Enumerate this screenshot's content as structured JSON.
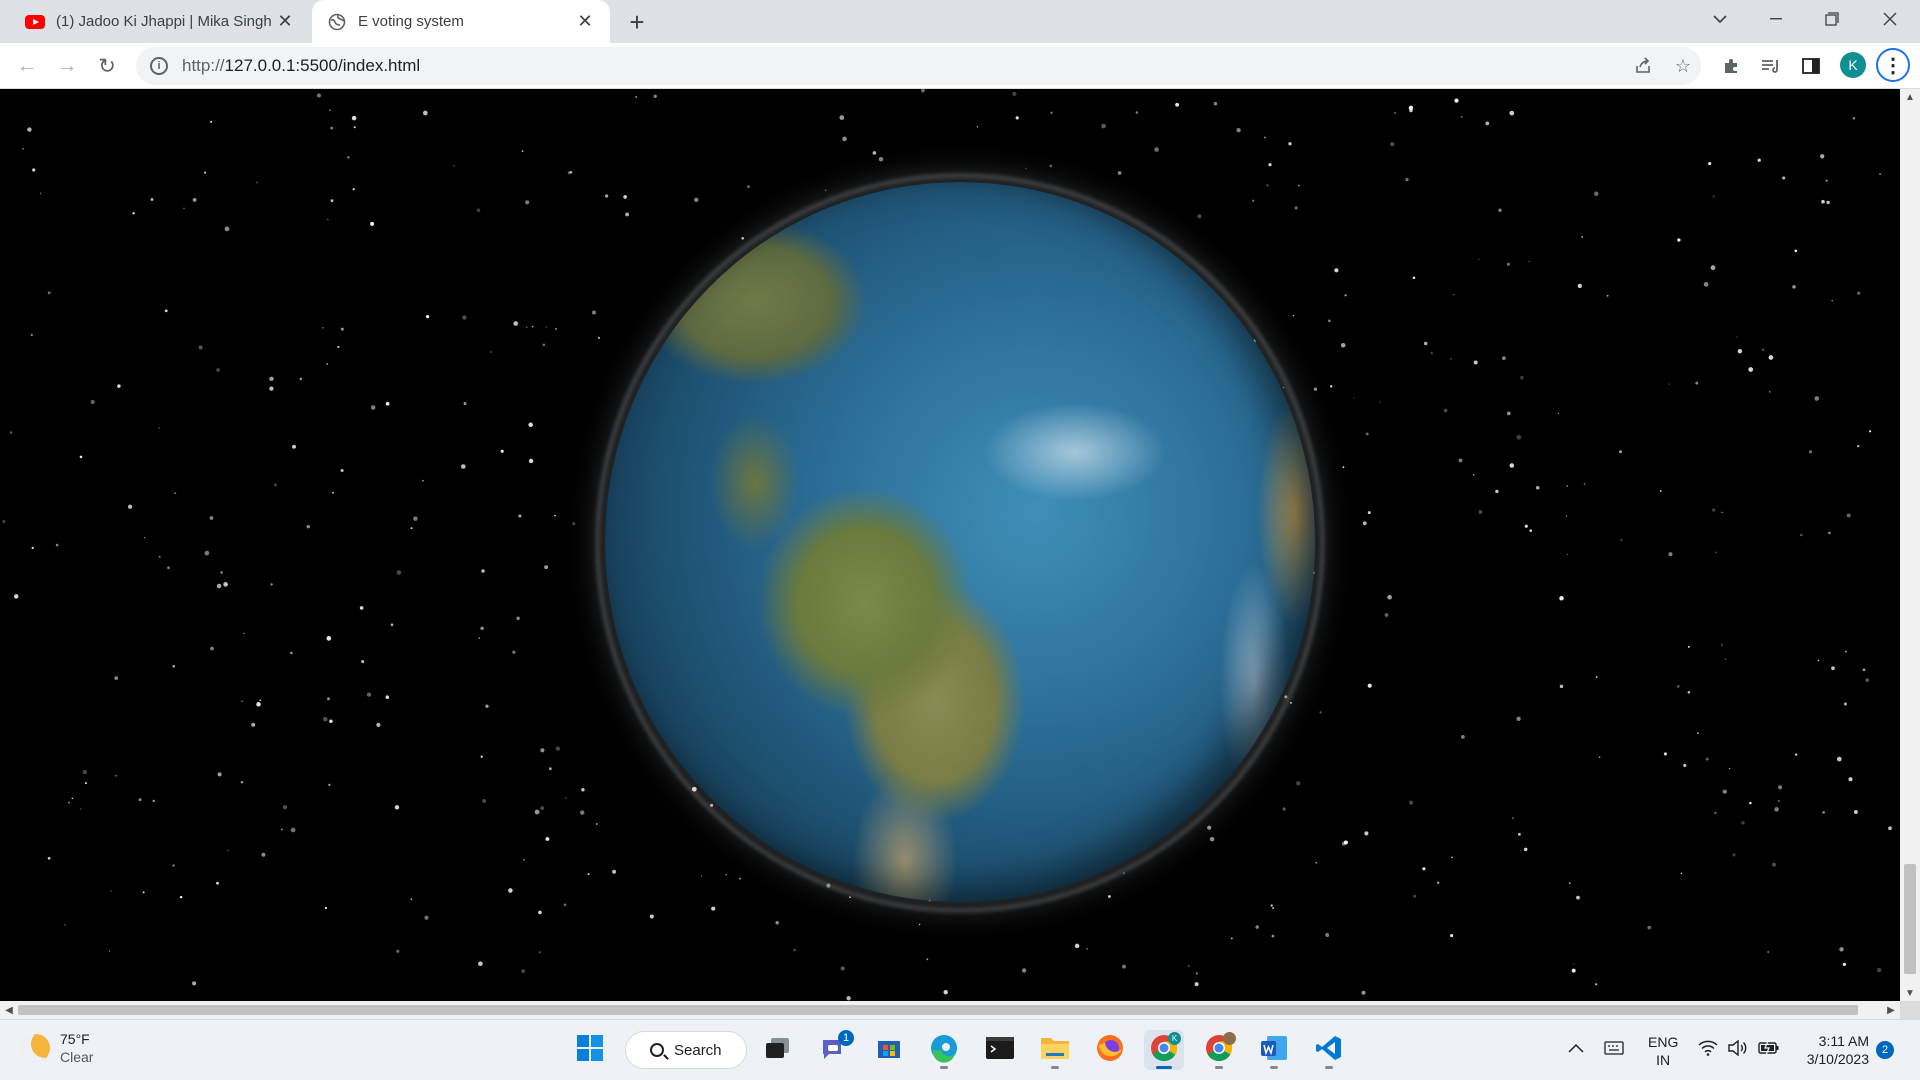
{
  "browser": {
    "tabs": [
      {
        "title": "(1) Jadoo Ki Jhappi | Mika Singh |",
        "icon": "youtube-icon",
        "active": false
      },
      {
        "title": "E voting system",
        "icon": "globe-icon",
        "active": true
      }
    ],
    "new_tab_label": "+",
    "address_bar": {
      "url_dim": "http://",
      "url_main": "127.0.0.1:5500/index.html"
    },
    "profile_initial": "K"
  },
  "page": {
    "content": "rotating-earth-on-starfield"
  },
  "taskbar": {
    "weather": {
      "temperature": "75°F",
      "condition": "Clear"
    },
    "search_label": "Search",
    "teams_badge": "1",
    "language": {
      "line1": "ENG",
      "line2": "IN"
    },
    "clock": {
      "time": "3:11 AM",
      "date": "3/10/2023"
    },
    "notification_count": "2"
  },
  "colors": {
    "accent": "#0067c0",
    "chrome_blue": "#1a73e8",
    "youtube_red": "#ff0000"
  }
}
